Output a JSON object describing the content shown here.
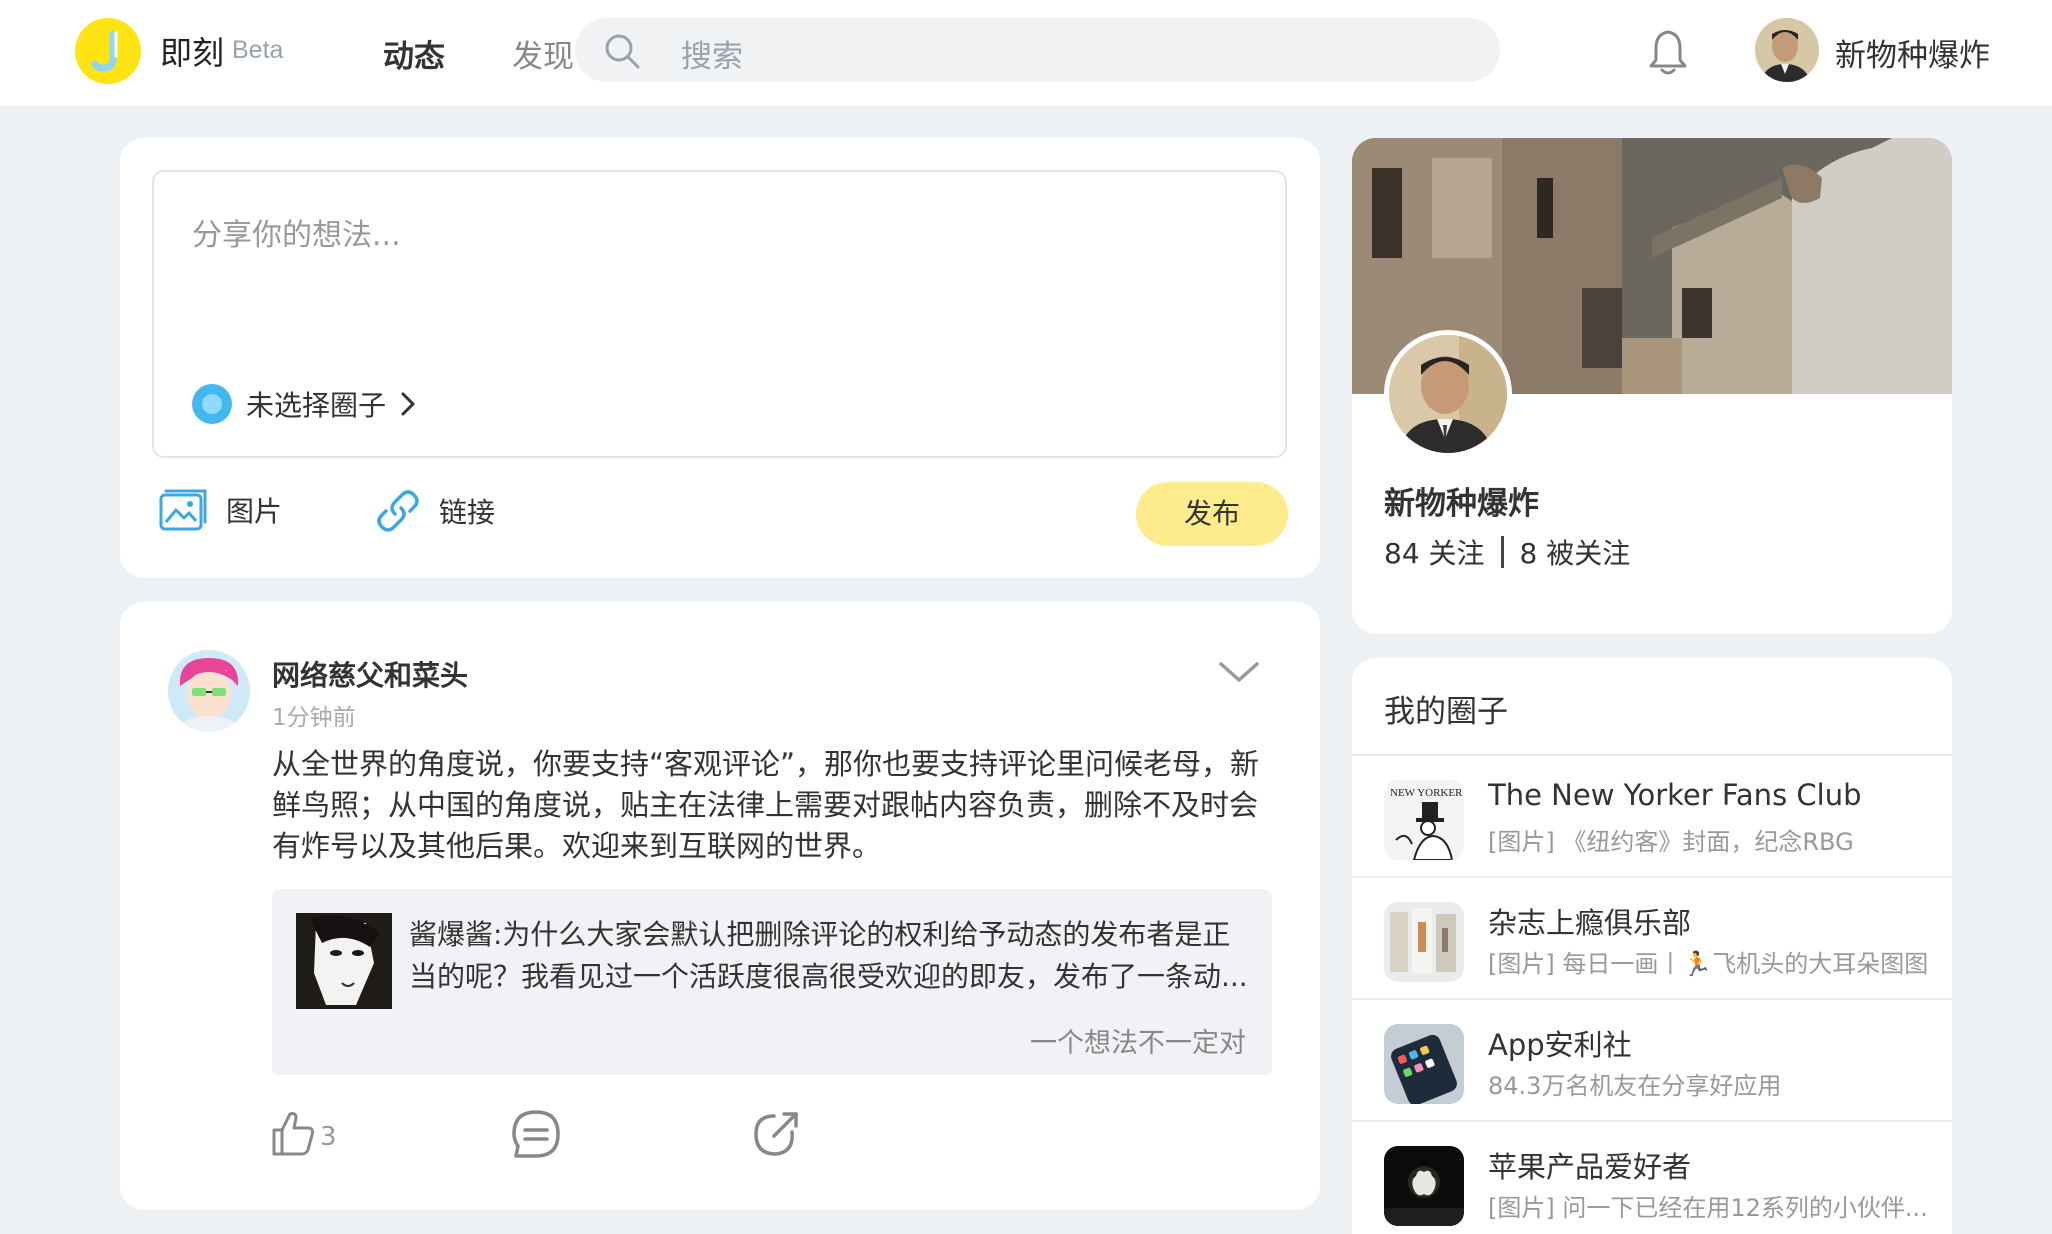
{
  "header": {
    "brand": "即刻",
    "beta": "Beta",
    "nav": [
      "动态",
      "发现"
    ],
    "search_placeholder": "搜索",
    "user_name": "新物种爆炸",
    "accent_color": "#ffe411"
  },
  "composer": {
    "placeholder": "分享你的想法...",
    "topic_label": "未选择圈子",
    "tools": [
      "图片",
      "链接"
    ],
    "publish_label": "发布"
  },
  "post": {
    "author": "网络慈父和菜头",
    "time": "1分钟前",
    "body": "从全世界的角度说，你要支持“客观评论”，那你也要支持评论里问候老母，新鲜鸟照；从中国的角度说，贴主在法律上需要对跟帖内容负责，删除不及时会有炸号以及其他后果。欢迎来到互联网的世界。",
    "quote_text": "酱爆酱:为什么大家会默认把删除评论的权利给予动态的发布者是正当的呢？我看见过一个活跃度很高很受欢迎的即友，发布了一条动...",
    "quote_topic": "一个想法不一定对",
    "like_count": "3"
  },
  "profile": {
    "name": "新物种爆炸",
    "following": "84 关注",
    "followers": "8 被关注"
  },
  "circles": {
    "title": "我的圈子",
    "items": [
      {
        "name": "The New Yorker Fans Club",
        "desc": "[图片] 《纽约客》封面，纪念RBG"
      },
      {
        "name": "杂志上瘾俱乐部",
        "desc": "[图片] 每日一画丨🏃飞机头的大耳朵图图"
      },
      {
        "name": "App安利社",
        "desc": "84.3万名机友在分享好应用"
      },
      {
        "name": "苹果产品爱好者",
        "desc": "[图片] 问一下已经在用12系列的小伙伴..."
      }
    ]
  }
}
